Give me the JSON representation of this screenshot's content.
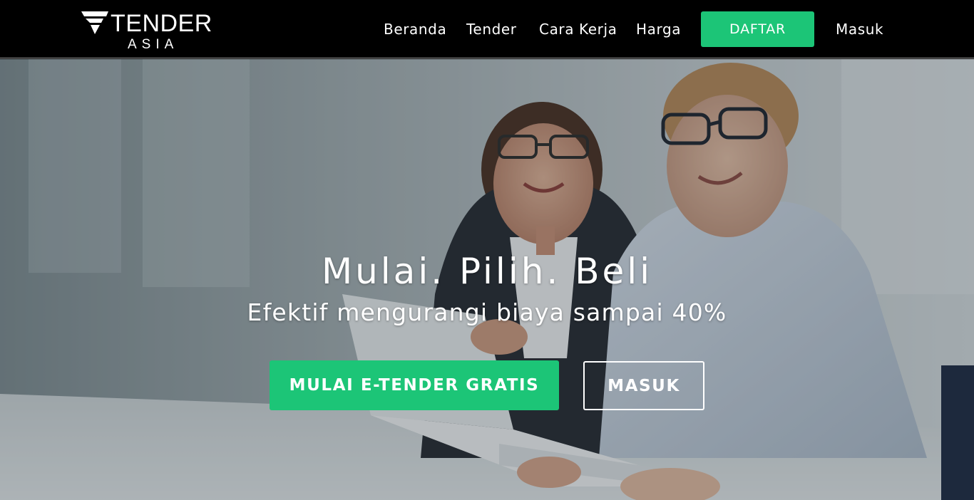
{
  "brand": {
    "name": "TENDER",
    "sub": "ASIA"
  },
  "nav": {
    "items": [
      {
        "label": "Beranda"
      },
      {
        "label": "Tender"
      },
      {
        "label": "Cara Kerja"
      },
      {
        "label": "Harga"
      }
    ],
    "signup_label": "DAFTAR",
    "login_label": "Masuk"
  },
  "hero": {
    "title": "Mulai. Pilih. Beli",
    "subtitle": "Efektif mengurangi biaya sampai 40%",
    "primary_cta": "MULAI E-TENDER GRATIS",
    "secondary_cta": "MASUK"
  },
  "colors": {
    "accent": "#1cc577",
    "header_bg": "#000000"
  }
}
